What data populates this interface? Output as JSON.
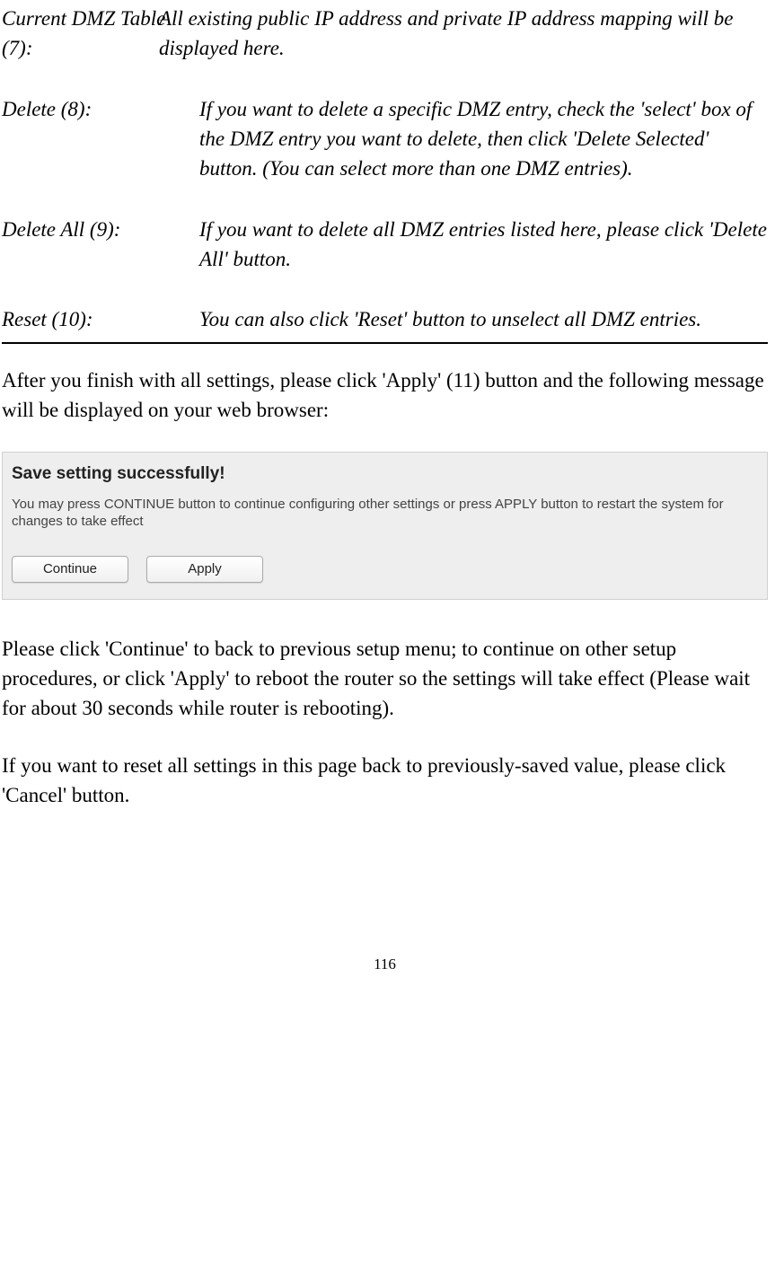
{
  "definitions": {
    "current_dmz_table": {
      "term": "Current DMZ Table (7):",
      "desc": "All existing public IP address and private IP address mapping will be displayed here."
    },
    "delete": {
      "term": "Delete (8):",
      "desc": "If you want to delete a specific DMZ entry, check the 'select' box of the DMZ entry you want to delete, then click 'Delete Selected' button. (You can select more than one DMZ entries)."
    },
    "delete_all": {
      "term": "Delete All (9):",
      "desc": "If you want to delete all DMZ entries listed here, please click 'Delete All' button."
    },
    "reset": {
      "term": "Reset (10):",
      "desc": "You can also click 'Reset' button to unselect all DMZ entries."
    }
  },
  "body": {
    "apply_instruction": "After you finish with all settings, please click 'Apply' (11) button and the following message will be displayed on your web browser:",
    "continue_instruction": "Please click 'Continue' to back to previous setup menu; to continue on other setup procedures, or click 'Apply' to reboot the router so the settings will take effect (Please wait for about 30 seconds while router is rebooting).",
    "cancel_instruction": "If you want to reset all settings in this page back to previously-saved value, please click 'Cancel' button."
  },
  "screenshot": {
    "title": "Save setting successfully!",
    "text": "You may press CONTINUE button to continue configuring other settings or press APPLY button to restart the system for changes to take effect",
    "continue_btn": "Continue",
    "apply_btn": "Apply"
  },
  "page_number": "116"
}
